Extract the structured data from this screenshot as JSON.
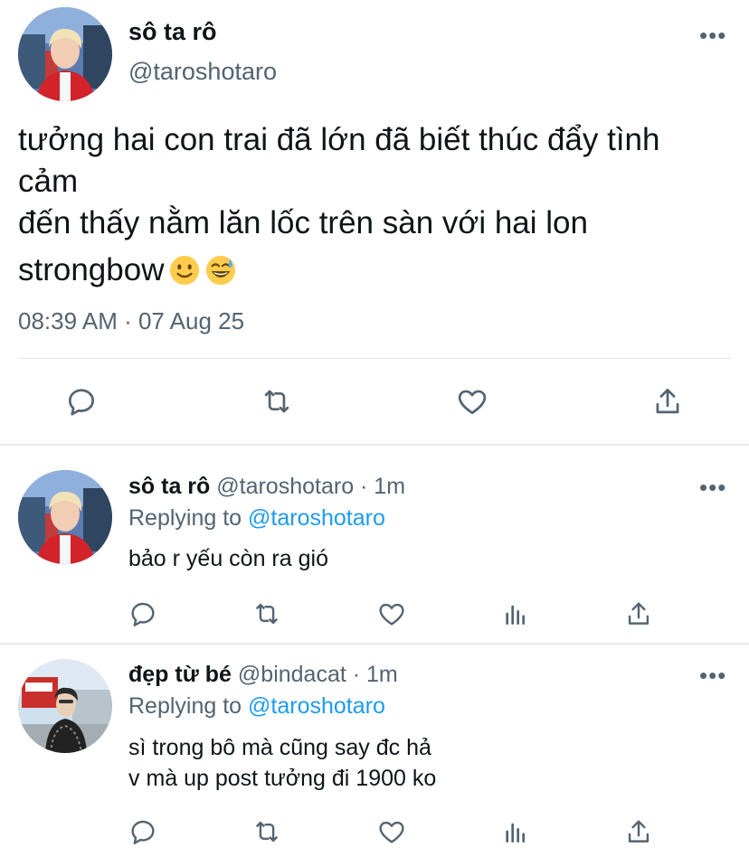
{
  "main_tweet": {
    "display_name": "sô ta rô",
    "handle": "@taroshotaro",
    "text_lines": [
      "tưởng hai con trai đã lớn đã biết thúc đẩy tình",
      "cảm",
      "đến thấy nằm lăn lốc trên sàn với hai lon",
      "strongbow"
    ],
    "emojis": [
      "slightly-smiling-face",
      "grinning-face-with-sweat"
    ],
    "timestamp": "08:39 AM · 07 Aug 25",
    "more_label": "•••",
    "actions": [
      "reply-icon",
      "retweet-icon",
      "like-icon",
      "share-icon"
    ]
  },
  "replies": [
    {
      "display_name": "sô ta rô",
      "meta": "@taroshotaro · 1m",
      "replying_prefix": "Replying to",
      "replying_to": "@taroshotaro",
      "text_lines": [
        "bảo r yếu còn ra gió"
      ],
      "more_label": "•••"
    },
    {
      "display_name": "đẹp từ bé",
      "meta": "@bindacat · 1m",
      "replying_prefix": "Replying to",
      "replying_to": "@taroshotaro",
      "text_lines": [
        "sì trong bô mà cũng say đc hả",
        "v mà up post tưởng đi 1900 ko"
      ],
      "more_label": "•••"
    }
  ],
  "colors": {
    "text": "#0f1419",
    "secondary": "#536471",
    "accent": "#1d9bf0",
    "divider": "#e1e5e8"
  }
}
